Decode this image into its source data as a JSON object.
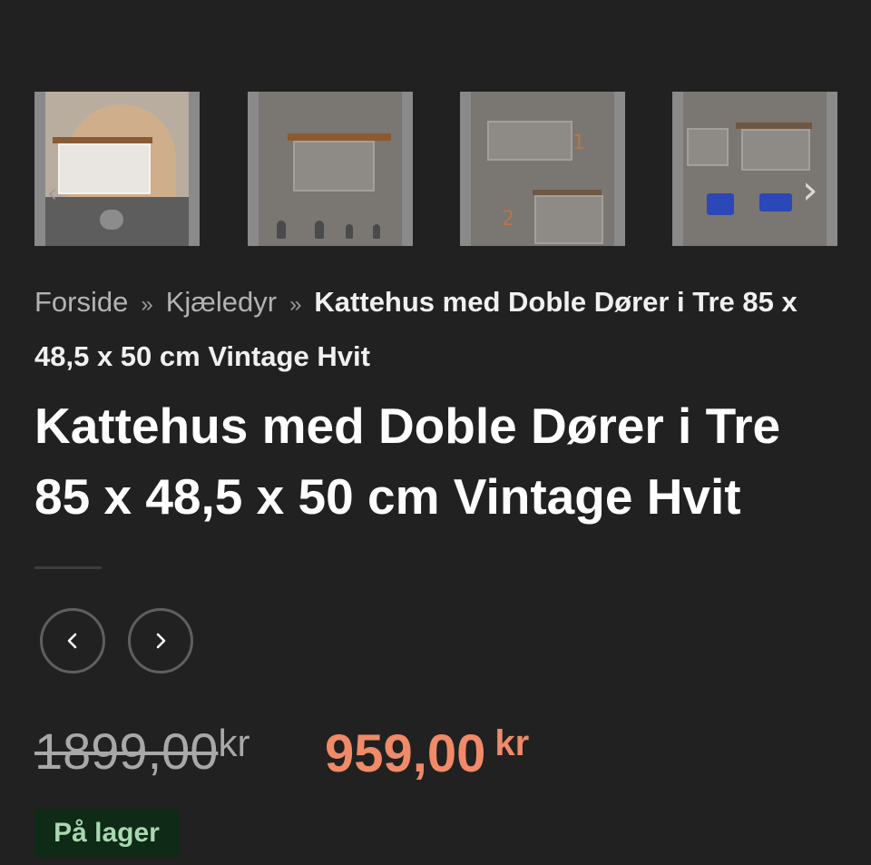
{
  "gallery": {
    "thumbnails": [
      {
        "alt": "thumbnail-1"
      },
      {
        "alt": "thumbnail-2"
      },
      {
        "alt": "thumbnail-3"
      },
      {
        "alt": "thumbnail-4"
      }
    ],
    "next_icon": "chevron-right-icon",
    "prev_icon": "chevron-left-icon"
  },
  "breadcrumb": {
    "home": "Forside",
    "separator": "»",
    "category": "Kjæledyr",
    "current": "Kattehus med Doble Dører i Tre 85 x 48,5 x 50 cm Vintage Hvit"
  },
  "product": {
    "title": "Kattehus med Doble Dører i Tre 85 x 48,5 x 50 cm Vintage Hvit",
    "old_price": "1899,00",
    "old_currency": "kr",
    "new_price": "959,00",
    "new_currency": "kr",
    "stock_label": "På lager"
  },
  "navigation": {
    "prev_icon": "chevron-left-icon",
    "next_icon": "chevron-right-icon"
  },
  "colors": {
    "background": "#212121",
    "sale_price": "#f08a68",
    "stock_bg": "#0f2a17",
    "stock_text": "#a9d8b0"
  }
}
